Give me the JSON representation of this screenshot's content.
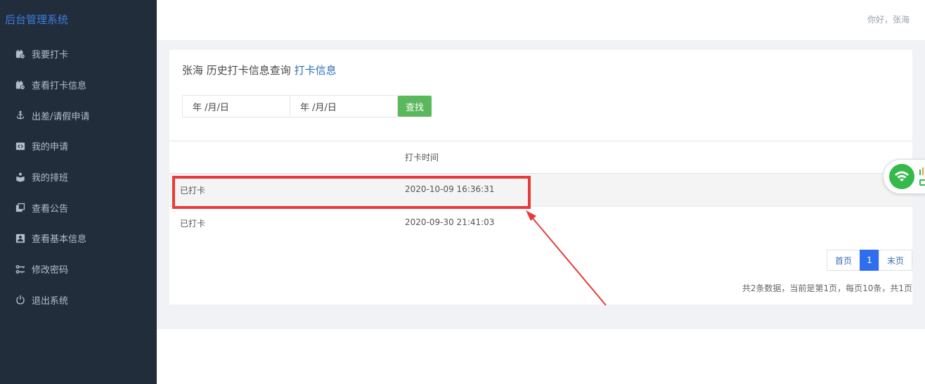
{
  "app": {
    "brand": "后台管理系统",
    "greeting": "你好，张海"
  },
  "sidebar": {
    "items": [
      {
        "label": "我要打卡",
        "icon": "calendar-clock-icon"
      },
      {
        "label": "查看打卡信息",
        "icon": "calendar-clock-icon"
      },
      {
        "label": "出差/请假申请",
        "icon": "anchor-icon"
      },
      {
        "label": "我的申请",
        "icon": "code-square-icon"
      },
      {
        "label": "我的排班",
        "icon": "reader-icon"
      },
      {
        "label": "查看公告",
        "icon": "copy-icon"
      },
      {
        "label": "查看基本信息",
        "icon": "id-card-icon"
      },
      {
        "label": "修改密码",
        "icon": "keys-icon"
      },
      {
        "label": "退出系统",
        "icon": "power-icon"
      }
    ]
  },
  "page": {
    "crumb_main": "张海 历史打卡信息查询",
    "crumb_sub": "打卡信息"
  },
  "filters": {
    "start_date_placeholder": "年 /月/日",
    "end_date_placeholder": "年 /月/日",
    "search_label": "查找"
  },
  "table": {
    "columns": [
      "",
      "打卡时间"
    ],
    "rows": [
      {
        "status": "已打卡",
        "time": "2020-10-09 16:36:31"
      },
      {
        "status": "已打卡",
        "time": "2020-09-30 21:41:03"
      }
    ]
  },
  "pagination": {
    "first": "首页",
    "current": "1",
    "last": "末页",
    "summary": "共2条数据，当前是第1页，每页10条，共1页"
  },
  "colors": {
    "sidebar_bg": "#222d3c",
    "accent": "#2f6fee",
    "search_button": "#5cb85c",
    "highlight": "#e83a3a"
  }
}
